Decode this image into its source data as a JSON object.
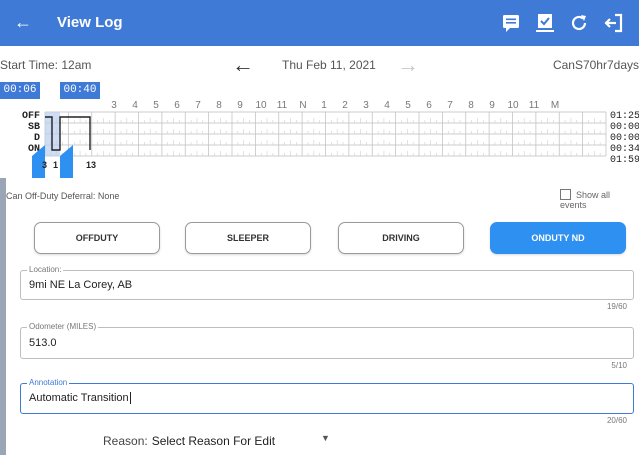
{
  "header": {
    "title": "View Log",
    "back_icon": "arrow-left-icon",
    "actions": [
      "message-icon",
      "certify-icon",
      "refresh-icon",
      "logout-icon"
    ]
  },
  "datebar": {
    "start_time": "Start Time: 12am",
    "date": "Thu Feb 11, 2021",
    "cycle": "CanS70hr7days"
  },
  "graph": {
    "start_tag": "00:06",
    "end_tag": "00:40",
    "hours": [
      "3",
      "4",
      "5",
      "6",
      "7",
      "8",
      "9",
      "10",
      "11",
      "N",
      "1",
      "2",
      "3",
      "4",
      "5",
      "6",
      "7",
      "8",
      "9",
      "10",
      "11",
      "M"
    ],
    "rows": [
      "OFF",
      "SB",
      "D",
      "ON"
    ],
    "totals": [
      "01:25",
      "00:00",
      "00:00",
      "00:34",
      "01:59"
    ],
    "markers": [
      "3",
      "1",
      "13"
    ]
  },
  "deferral": "Can Off-Duty Deferral: None",
  "show_all_events": "Show all events",
  "status_buttons": [
    {
      "label": "OFFDUTY",
      "active": false
    },
    {
      "label": "SLEEPER",
      "active": false
    },
    {
      "label": "DRIVING",
      "active": false
    },
    {
      "label": "ONDUTY ND",
      "active": true
    }
  ],
  "location": {
    "label": "Location:",
    "value": "9mi NE La Corey, AB",
    "counter": "19/60"
  },
  "odometer": {
    "label": "Odometer (MILES)",
    "value": "513.0",
    "counter": "5/10"
  },
  "annotation": {
    "label": "Annotation",
    "value": "Automatic Transition",
    "counter": "20/60"
  },
  "reason": {
    "label": "Reason:",
    "value": "Select Reason For Edit"
  },
  "colors": {
    "primary": "#3f7ad6",
    "active_button": "#2e90f0"
  }
}
